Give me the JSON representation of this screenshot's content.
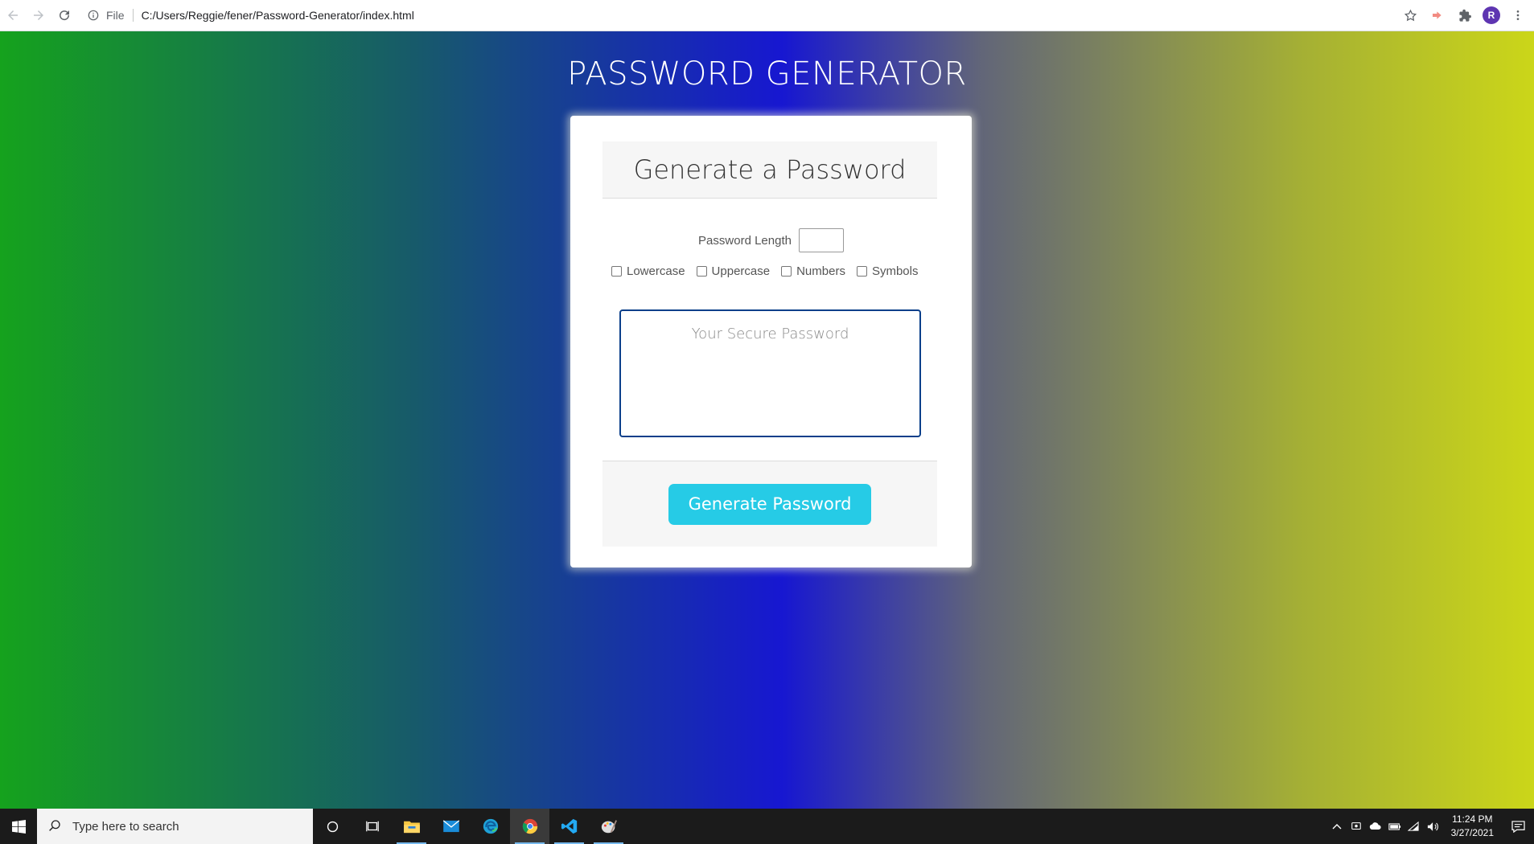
{
  "browser": {
    "file_label": "File",
    "url": "C:/Users/Reggie/fener/Password-Generator/index.html",
    "avatar_initial": "R"
  },
  "page": {
    "title": "PASSWORD GENERATOR",
    "card": {
      "heading": "Generate a Password",
      "length_label": "Password Length",
      "length_value": "",
      "options": [
        {
          "label": "Lowercase",
          "checked": false
        },
        {
          "label": "Uppercase",
          "checked": false
        },
        {
          "label": "Numbers",
          "checked": false
        },
        {
          "label": "Symbols",
          "checked": false
        }
      ],
      "password_placeholder": "Your Secure Password",
      "generate_button": "Generate Password"
    }
  },
  "taskbar": {
    "search_placeholder": "Type here to search",
    "time": "11:24 PM",
    "date": "3/27/2021",
    "pinned": [
      "cortana-icon",
      "task-view-icon",
      "file-explorer-icon",
      "mail-icon",
      "edge-icon",
      "chrome-icon",
      "vscode-icon",
      "paint-icon"
    ],
    "active_app": "chrome-icon"
  },
  "colors": {
    "gradient": [
      "#15a21d",
      "#175a6a",
      "#1717d1",
      "#626678",
      "#a5b034",
      "#cbd619"
    ],
    "button": "#26cbe6",
    "password_border": "#0a3f8a"
  }
}
